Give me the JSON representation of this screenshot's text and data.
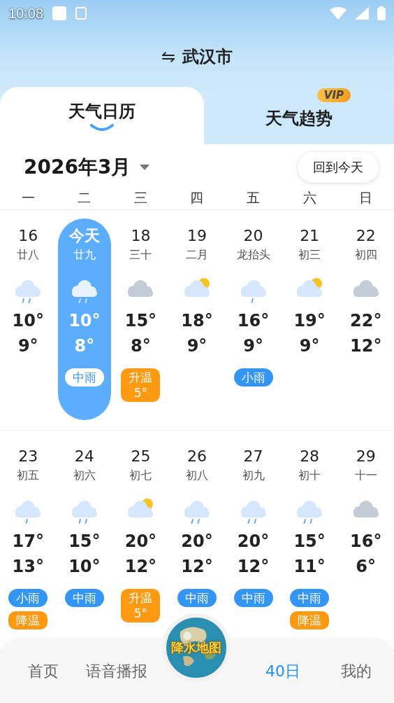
{
  "status_bar": {
    "time": "10:08"
  },
  "header": {
    "city": "武汉市",
    "switch_icon": "⇋"
  },
  "tabs": [
    {
      "label": "天气日历",
      "selected": true
    },
    {
      "label": "天气趋势",
      "selected": false,
      "badge": "VIP"
    }
  ],
  "month": {
    "title": "2026年3月",
    "today_button": "回到今天"
  },
  "weekdays": [
    "一",
    "二",
    "三",
    "四",
    "五",
    "六",
    "日"
  ],
  "weeks": [
    {
      "days": [
        {
          "date": "16",
          "lunar": "廿八",
          "kind": "heavy_rain",
          "high": "10°",
          "low": "9°",
          "selected": false
        },
        {
          "date": "今天",
          "lunar": "廿九",
          "kind": "heavy_rain",
          "high": "10°",
          "low": "8°",
          "selected": true,
          "tags": [
            {
              "kind": "rain",
              "label": "中雨"
            }
          ]
        },
        {
          "date": "18",
          "lunar": "三十",
          "kind": "cloudy",
          "high": "15°",
          "low": "8°",
          "selected": false,
          "tags": [
            {
              "kind": "temp",
              "label": "升温",
              "sub": "5°"
            }
          ]
        },
        {
          "date": "19",
          "lunar": "二月",
          "kind": "partly",
          "high": "18°",
          "low": "9°",
          "selected": false
        },
        {
          "date": "20",
          "lunar": "龙抬头",
          "kind": "light_rain",
          "high": "16°",
          "low": "9°",
          "selected": false,
          "tags": [
            {
              "kind": "rain",
              "label": "小雨"
            }
          ]
        },
        {
          "date": "21",
          "lunar": "初三",
          "kind": "partly",
          "high": "19°",
          "low": "9°",
          "selected": false
        },
        {
          "date": "22",
          "lunar": "初四",
          "kind": "cloudy",
          "high": "22°",
          "low": "12°",
          "selected": false
        }
      ]
    },
    {
      "days": [
        {
          "date": "23",
          "lunar": "初五",
          "kind": "light_rain",
          "high": "17°",
          "low": "13°",
          "selected": false,
          "tags": [
            {
              "kind": "rain",
              "label": "小雨"
            },
            {
              "kind": "temp",
              "label": "降温"
            }
          ]
        },
        {
          "date": "24",
          "lunar": "初六",
          "kind": "heavy_rain",
          "high": "15°",
          "low": "10°",
          "selected": false,
          "tags": [
            {
              "kind": "rain",
              "label": "中雨"
            }
          ]
        },
        {
          "date": "25",
          "lunar": "初七",
          "kind": "partly",
          "high": "20°",
          "low": "12°",
          "selected": false,
          "tags": [
            {
              "kind": "temp",
              "label": "升温",
              "sub": "5°"
            }
          ]
        },
        {
          "date": "26",
          "lunar": "初八",
          "kind": "heavy_rain",
          "high": "20°",
          "low": "12°",
          "selected": false,
          "tags": [
            {
              "kind": "rain",
              "label": "中雨"
            }
          ]
        },
        {
          "date": "27",
          "lunar": "初九",
          "kind": "heavy_rain",
          "high": "20°",
          "low": "12°",
          "selected": false,
          "tags": [
            {
              "kind": "rain",
              "label": "中雨"
            }
          ]
        },
        {
          "date": "28",
          "lunar": "初十",
          "kind": "heavy_rain",
          "high": "15°",
          "low": "11°",
          "selected": false,
          "tags": [
            {
              "kind": "rain",
              "label": "中雨"
            },
            {
              "kind": "temp",
              "label": "降温"
            }
          ]
        },
        {
          "date": "29",
          "lunar": "十一",
          "kind": "cloudy",
          "high": "16°",
          "low": "6°",
          "selected": false
        }
      ]
    }
  ],
  "bottom_nav": {
    "items": [
      {
        "label": "首页",
        "selected": false
      },
      {
        "label": "语音播报",
        "selected": false
      },
      {
        "label": "40日",
        "selected": true
      },
      {
        "label": "我的",
        "selected": false
      }
    ],
    "center_button": "降水地图"
  }
}
